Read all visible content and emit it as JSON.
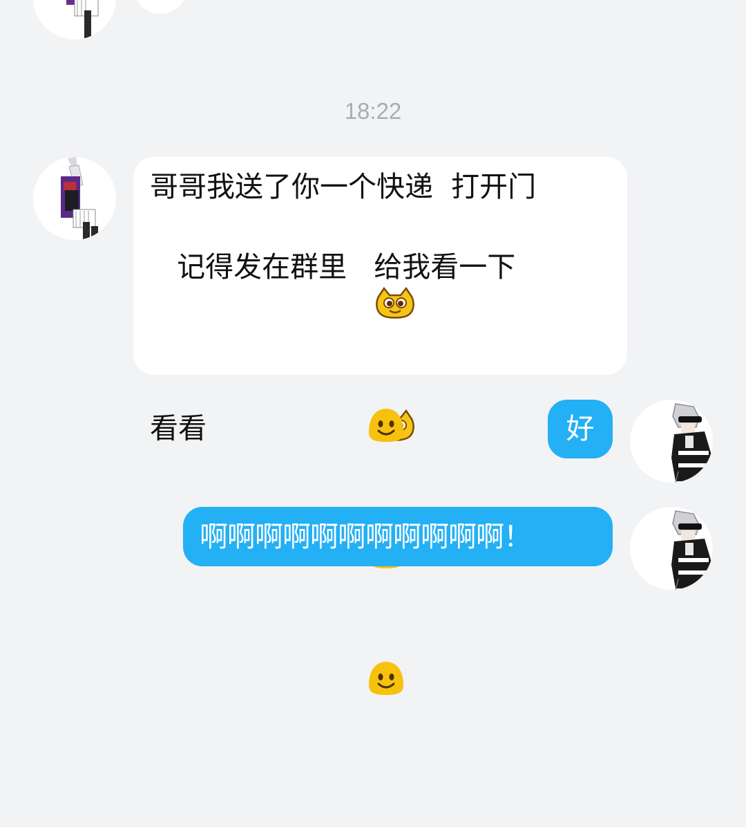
{
  "conversation": {
    "timestamp": "18:22",
    "incoming": {
      "line1": "哥哥我送了你一个快递  打开门",
      "line2_text": "看看",
      "line2_emojis": [
        "cat-face-emoji",
        "cat-face-emoji",
        "cat-face-emoji"
      ],
      "line3": "   记得发在群里   给我看一下",
      "line4_emojis": [
        "smile-emoji",
        "smile-emoji",
        "smile-emoji"
      ]
    },
    "outgoing": [
      {
        "text": "好"
      },
      {
        "text": "啊啊啊啊啊啊啊啊啊啊啊！"
      }
    ]
  },
  "colors": {
    "background": "#f2f3f5",
    "incoming_bubble": "#ffffff",
    "outgoing_bubble": "#23b0f5",
    "timestamp": "#a8acb3"
  }
}
